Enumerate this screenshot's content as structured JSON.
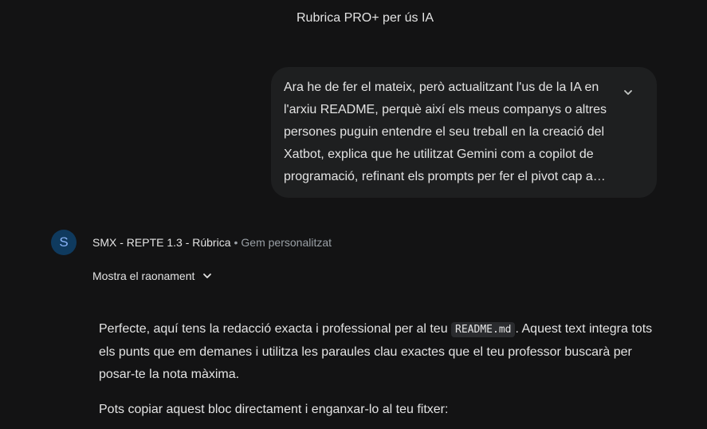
{
  "attachment": {
    "title": "Rubrica PRO+ per ús IA"
  },
  "user_message": {
    "text": "Ara he de fer el mateix, però actualitzant l'us de la IA en l'arxiu README, perquè així els meus companys o altres persones puguin entendre el seu treball en la creació del Xatbot, explica que he utilitzat Gemini com a copilot de programació, refinant els prompts per fer el pivot cap a…",
    "expand_icon": "chevron-down-icon"
  },
  "assistant": {
    "avatar_letter": "S",
    "gem_name": "SMX - REPTE 1.3 - Rúbrica",
    "separator": "•",
    "gem_type": "Gem personalitzat",
    "reasoning_label": "Mostra el raonament",
    "reasoning_icon": "chevron-down-icon",
    "response": {
      "p1_before": "Perfecte, aquí tens la redacció exacta i professional per al teu ",
      "p1_code": "README.md",
      "p1_after": ". Aquest text integra tots els punts que em demanes i utilitza les paraules clau exactes que el teu professor buscarà per posar-te la nota màxima.",
      "p2": "Pots copiar aquest bloc directament i enganxar-lo al teu fitxer:"
    }
  },
  "colors": {
    "background": "#131314",
    "bubble": "#1e1f20",
    "avatar_bg": "#0f3a5e",
    "avatar_fg": "#8ab4f8",
    "muted": "#9aa0a6"
  }
}
